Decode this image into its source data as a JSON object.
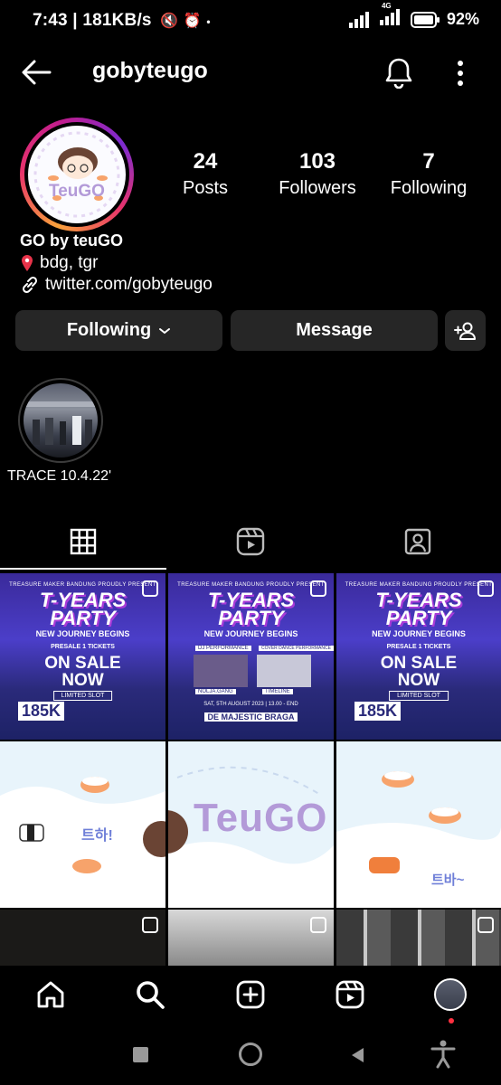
{
  "status_bar": {
    "time": "7:43",
    "speed": "181KB/s",
    "network": "4G",
    "battery": "92%"
  },
  "header": {
    "username": "gobyteugo"
  },
  "profile": {
    "logo_text": "TeuGO",
    "stats": [
      {
        "value": "24",
        "label": "Posts"
      },
      {
        "value": "103",
        "label": "Followers"
      },
      {
        "value": "7",
        "label": "Following"
      }
    ],
    "name": "GO by teuGO",
    "location": "bdg, tgr",
    "link": "twitter.com/gobyteugo"
  },
  "actions": {
    "following_label": "Following",
    "message_label": "Message"
  },
  "highlights": [
    {
      "label": "TRACE 10.4.22'"
    }
  ],
  "posts": {
    "party": {
      "top_line": "TREASURE MAKER BANDUNG PROUDLY PRESENT",
      "title_line1": "T-YEARS",
      "title_line2": "PARTY",
      "subtitle": "NEW JOURNEY BEGINS",
      "presale": "PRESALE 1 TICKETS",
      "onsale_line1": "ON SALE",
      "onsale_line2": "NOW",
      "limited": "LIMITED SLOT",
      "price": "185K",
      "dj": "DJ PERFORMANCE",
      "cover": "COVER DANCE PERFORMANCE",
      "group1": "NOLJA.GANG",
      "group2": "TIMELINE",
      "date": "SAT, 5TH AUGUST 2023 | 13.00 - END",
      "venue": "DE MAJESTIC BRAGA"
    },
    "sticker_1": "트하!",
    "sticker_2": "트바~"
  },
  "colors": {
    "background": "#000000",
    "button": "#262626",
    "accent_ring": "#e8336b",
    "notification_dot": "#ff3040"
  }
}
